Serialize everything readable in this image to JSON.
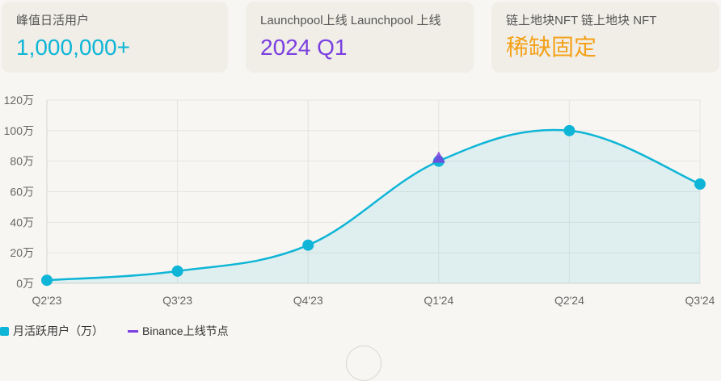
{
  "cards": [
    {
      "label": "峰值日活用户",
      "value": "1,000,000+",
      "color": "#0fb5d6"
    },
    {
      "label": "Launchpool上线  Launchpool 上线",
      "value": "2024 Q1",
      "color": "#7b3fe0"
    },
    {
      "label": "链上地块NFT  链上地块 NFT",
      "value": "稀缺固定",
      "color": "#f5a11a"
    }
  ],
  "chart_data": {
    "type": "area",
    "categories": [
      "Q2'23",
      "Q3'23",
      "Q4'23",
      "Q1'24",
      "Q2'24",
      "Q3'24"
    ],
    "series": [
      {
        "name": "月活跃用户（万）",
        "values": [
          2,
          8,
          25,
          80,
          100,
          65
        ],
        "color": "#0fb5d6"
      }
    ],
    "markers": [
      {
        "name": "Binance上线节点",
        "category": "Q1'24",
        "value": 80,
        "color": "#7b3fe0"
      }
    ],
    "yticks": [
      "0万",
      "20万",
      "40万",
      "60万",
      "80万",
      "100万",
      "120万"
    ],
    "ylim": [
      0,
      120
    ],
    "grid": true,
    "legend_position": "bottom-left"
  },
  "legend": [
    {
      "label": "月活跃用户（万）",
      "color": "#0fb5d6",
      "shape": "box"
    },
    {
      "label": "Binance上线节点",
      "color": "#7b3fe0",
      "shape": "line"
    }
  ]
}
